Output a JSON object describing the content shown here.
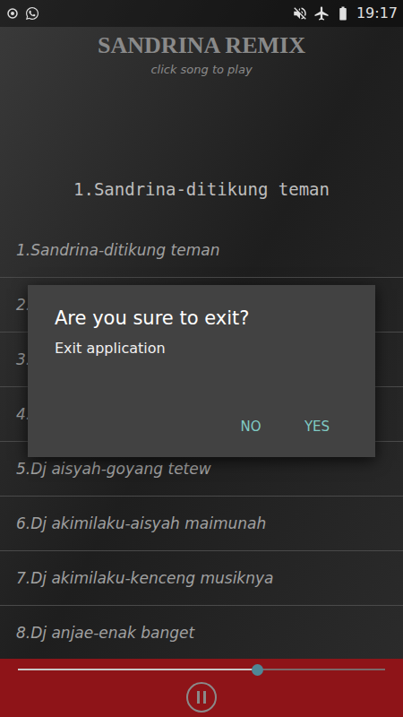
{
  "status_bar": {
    "time": "19:17"
  },
  "header": {
    "title": "SANDRINA REMIX",
    "subtitle": "click song to play"
  },
  "now_playing": "1.Sandrina-ditikung teman",
  "songs": [
    {
      "title": "1.Sandrina-ditikung teman"
    },
    {
      "title": "2."
    },
    {
      "title": "3."
    },
    {
      "title": "4."
    },
    {
      "title": "5.Dj aisyah-goyang tetew"
    },
    {
      "title": "6.Dj akimilaku-aisyah maimunah"
    },
    {
      "title": "7.Dj akimilaku-kenceng musiknya"
    },
    {
      "title": "8.Dj anjae-enak banget"
    }
  ],
  "dialog": {
    "title": "Are you sure to exit?",
    "message": "Exit application",
    "buttons": [
      "NO",
      "YES"
    ]
  },
  "player": {
    "level": 0.65,
    "playing": true
  }
}
